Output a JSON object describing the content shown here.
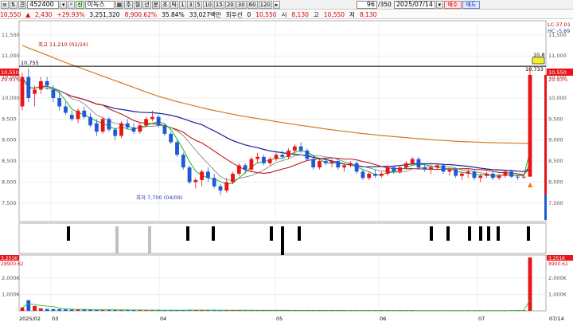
{
  "toolbar": {
    "code": "452400",
    "period_tabs": [
      "주",
      "월",
      "년",
      "분",
      "초",
      "틱"
    ],
    "minute_options": [
      "1",
      "3",
      "5",
      "10",
      "15",
      "20",
      "30",
      "60",
      "120"
    ],
    "count_value": "96",
    "count_total": "/350",
    "date": "2025/07/14",
    "buy_label": "매수",
    "sell_label": "매도"
  },
  "quote": {
    "price": "10,550",
    "change": "2,430",
    "change_pct": "+29.93%",
    "volume": "3,251,320",
    "volume_ratio": "8,900.62%",
    "turnover_pct": "35.84%",
    "amount": "33,027백만",
    "pref_label": "회우선",
    "pref_value": "0",
    "last_close": "10,550",
    "open_label": "시",
    "open": "8,130",
    "high_label": "고",
    "high": "10,550",
    "low_label": "저",
    "low": "8,130"
  },
  "colors": {
    "up": "#e8141a",
    "down": "#1d5bd6",
    "ma5": "#1fb51f",
    "ma10": "#7a7a7a",
    "ma20": "#b81c1c",
    "ma60": "#1a1aa0",
    "ma120": "#d27a1f",
    "price_tag_bg": "#e8141a",
    "high_box_bg": "#f4ef2a"
  },
  "price_chart": {
    "ylim": [
      7100,
      11800
    ],
    "y_ticks": [
      "11,500",
      "11,000",
      "10,500",
      "10,000",
      "9,500",
      "9,000",
      "8,500",
      "8,000",
      "7,500"
    ],
    "y_tick_values": [
      11500,
      11000,
      10500,
      10000,
      9500,
      9000,
      8500,
      8000,
      7500
    ],
    "hline_value": 10755,
    "hline_label": "10,755",
    "right_label_top1": "LC:37.01",
    "right_label_top2": "HC:-5.89",
    "right_high_label": "10,8",
    "right_close_label": "10,550",
    "right_close_pct": "29.93%",
    "left_close_label": "10,550",
    "left_close_pct": "29.93%",
    "last_high_label": "10,733",
    "max_annotation": "최고 11,210 (02/24)",
    "min_annotation": "최저 7,700 (04/09)"
  },
  "signal_strip": {
    "note": "event markers"
  },
  "volume_chart": {
    "y_ticks": [
      "2,000K",
      "1,000K"
    ],
    "y_tick_values": [
      2000000,
      1000000
    ],
    "ymax": 3300000,
    "top_right_label": "3,251K",
    "top_right_pct": "8900.62",
    "top_left_label": "3,251K",
    "top_left_pct": "28900.62"
  },
  "x_axis": {
    "labels": [
      "2025/02",
      "03",
      "04",
      "05",
      "06",
      "07"
    ],
    "right_label": "07/14"
  },
  "chart_data": {
    "type": "candlestick",
    "dates_note": "daily bars 2025/02 - 2025/07/14",
    "candles": [
      [
        9800,
        10600,
        9700,
        10500
      ],
      [
        10500,
        10700,
        9900,
        10000
      ],
      [
        10100,
        10300,
        9800,
        10200
      ],
      [
        10200,
        10500,
        10100,
        10400
      ],
      [
        10400,
        10500,
        10200,
        10300
      ],
      [
        10200,
        10300,
        9900,
        10000
      ],
      [
        10000,
        10150,
        9700,
        9800
      ],
      [
        9800,
        9900,
        9600,
        9650
      ],
      [
        9600,
        9700,
        9450,
        9500
      ],
      [
        9500,
        9750,
        9400,
        9700
      ],
      [
        9700,
        9800,
        9500,
        9550
      ],
      [
        9550,
        9650,
        9300,
        9350
      ],
      [
        9400,
        9500,
        9100,
        9200
      ],
      [
        9200,
        9550,
        9150,
        9500
      ],
      [
        9500,
        9550,
        9200,
        9250
      ],
      [
        9250,
        9300,
        9000,
        9100
      ],
      [
        9100,
        9450,
        9050,
        9400
      ],
      [
        9400,
        9500,
        9250,
        9300
      ],
      [
        9300,
        9400,
        9150,
        9200
      ],
      [
        9200,
        9400,
        9150,
        9350
      ],
      [
        9350,
        9550,
        9300,
        9500
      ],
      [
        9500,
        9700,
        9450,
        9550
      ],
      [
        9550,
        9600,
        9300,
        9350
      ],
      [
        9350,
        9400,
        9100,
        9150
      ],
      [
        9150,
        9200,
        8900,
        8950
      ],
      [
        8950,
        9000,
        8600,
        8650
      ],
      [
        8650,
        8700,
        8300,
        8350
      ],
      [
        8350,
        8400,
        7950,
        8000
      ],
      [
        8000,
        8100,
        7850,
        8050
      ],
      [
        8050,
        8300,
        7900,
        8250
      ],
      [
        8250,
        8350,
        8000,
        8100
      ],
      [
        8100,
        8200,
        7850,
        7900
      ],
      [
        7900,
        7950,
        7700,
        7800
      ],
      [
        7800,
        8100,
        7750,
        8000
      ],
      [
        8000,
        8250,
        7950,
        8200
      ],
      [
        8200,
        8450,
        8150,
        8400
      ],
      [
        8400,
        8450,
        8200,
        8300
      ],
      [
        8300,
        8600,
        8250,
        8550
      ],
      [
        8550,
        8700,
        8450,
        8600
      ],
      [
        8600,
        8650,
        8400,
        8450
      ],
      [
        8450,
        8600,
        8400,
        8550
      ],
      [
        8550,
        8700,
        8500,
        8650
      ],
      [
        8650,
        8750,
        8550,
        8600
      ],
      [
        8600,
        8800,
        8550,
        8750
      ],
      [
        8750,
        8900,
        8650,
        8850
      ],
      [
        8850,
        8950,
        8700,
        8750
      ],
      [
        8750,
        8800,
        8500,
        8550
      ],
      [
        8550,
        8650,
        8300,
        8350
      ],
      [
        8350,
        8550,
        8300,
        8500
      ],
      [
        8500,
        8600,
        8400,
        8450
      ],
      [
        8450,
        8550,
        8350,
        8500
      ],
      [
        8500,
        8550,
        8300,
        8350
      ],
      [
        8350,
        8450,
        8250,
        8400
      ],
      [
        8400,
        8500,
        8350,
        8450
      ],
      [
        8450,
        8500,
        8200,
        8250
      ],
      [
        8250,
        8300,
        8050,
        8100
      ],
      [
        8100,
        8250,
        8050,
        8200
      ],
      [
        8200,
        8300,
        8100,
        8150
      ],
      [
        8150,
        8250,
        8100,
        8200
      ],
      [
        8200,
        8400,
        8150,
        8350
      ],
      [
        8350,
        8400,
        8200,
        8250
      ],
      [
        8250,
        8400,
        8200,
        8350
      ],
      [
        8350,
        8500,
        8300,
        8450
      ],
      [
        8450,
        8600,
        8400,
        8550
      ],
      [
        8550,
        8600,
        8300,
        8350
      ],
      [
        8350,
        8450,
        8250,
        8300
      ],
      [
        8300,
        8400,
        8200,
        8350
      ],
      [
        8350,
        8450,
        8300,
        8400
      ],
      [
        8400,
        8450,
        8200,
        8250
      ],
      [
        8250,
        8350,
        8150,
        8300
      ],
      [
        8300,
        8350,
        8100,
        8150
      ],
      [
        8150,
        8250,
        8050,
        8200
      ],
      [
        8200,
        8300,
        8100,
        8250
      ],
      [
        8250,
        8300,
        8050,
        8100
      ],
      [
        8100,
        8200,
        8000,
        8150
      ],
      [
        8150,
        8250,
        8100,
        8200
      ],
      [
        8200,
        8250,
        8050,
        8100
      ],
      [
        8100,
        8200,
        8050,
        8150
      ],
      [
        8150,
        8300,
        8100,
        8250
      ],
      [
        8250,
        8300,
        8100,
        8130
      ],
      [
        8130,
        8180,
        8050,
        8120
      ],
      [
        8120,
        8200,
        8080,
        8130
      ],
      [
        8130,
        10733,
        8130,
        10550
      ]
    ],
    "volume": [
      200000,
      650000,
      300000,
      150000,
      120000,
      110000,
      100000,
      90000,
      85000,
      80000,
      75000,
      70000,
      65000,
      60000,
      60000,
      55000,
      55000,
      50000,
      50000,
      50000,
      48000,
      46000,
      44000,
      42000,
      42000,
      45000,
      50000,
      55000,
      50000,
      48000,
      45000,
      44000,
      43000,
      40000,
      38000,
      37000,
      36000,
      35000,
      34000,
      33000,
      32000,
      32000,
      31000,
      30000,
      30000,
      29000,
      29000,
      28000,
      28000,
      27000,
      27000,
      26000,
      26000,
      25000,
      25000,
      24000,
      24000,
      24000,
      23000,
      23000,
      22000,
      22000,
      22000,
      21000,
      21000,
      21000,
      20000,
      20000,
      20000,
      20000,
      19000,
      19000,
      19000,
      19000,
      18000,
      18000,
      18000,
      18000,
      18000,
      36000,
      36000,
      36000,
      3251320
    ],
    "ma120": [
      11250,
      11150,
      11060,
      10960,
      10860,
      10770,
      10680,
      10590,
      10500,
      10410,
      10320,
      10230,
      10140,
      10050,
      9980,
      9910,
      9850,
      9790,
      9730,
      9680,
      9630,
      9580,
      9540,
      9500,
      9460,
      9420,
      9380,
      9345,
      9310,
      9275,
      9240,
      9210,
      9180,
      9150,
      9125,
      9100,
      9080,
      9060,
      9040,
      9020,
      9000,
      8985,
      8970,
      8960,
      8950,
      8940,
      8935,
      8930,
      8925,
      8920
    ]
  }
}
